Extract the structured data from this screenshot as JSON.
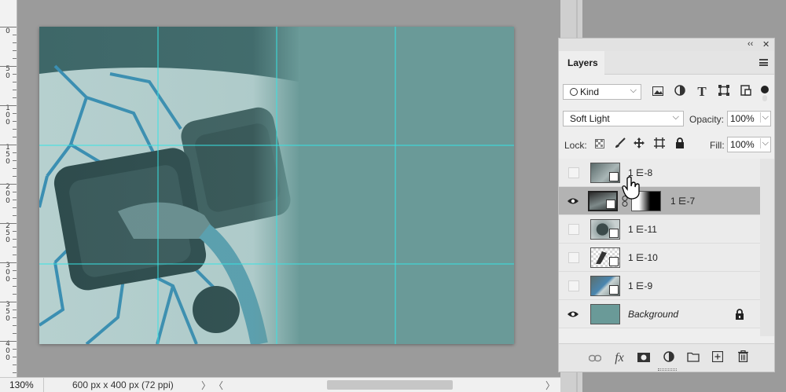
{
  "ruler": {
    "labels": [
      {
        "text": "0"
      },
      {
        "text": "5\n0"
      },
      {
        "text": "1\n0\n0"
      },
      {
        "text": "1\n5\n0"
      },
      {
        "text": "2\n0\n0"
      },
      {
        "text": "2\n5\n0"
      },
      {
        "text": "3\n0\n0"
      },
      {
        "text": "3\n5\n0"
      },
      {
        "text": "4\n0\n0"
      }
    ]
  },
  "panel": {
    "collapse_icon": "‹‹",
    "close_icon": "✕",
    "tab_label": "Layers",
    "filter": {
      "label": "Kind",
      "chevron": "⌵"
    },
    "blend_mode": {
      "value": "Soft Light",
      "chevron": "⌵"
    },
    "opacity": {
      "label": "Opacity:",
      "value": "100%",
      "chevron": "⌵"
    },
    "lock": {
      "label": "Lock:"
    },
    "fill": {
      "label": "Fill:",
      "value": "100%",
      "chevron": "⌵"
    },
    "layers": [
      {
        "name": "1 ⋿-8",
        "visible": false,
        "selected": false
      },
      {
        "name": "1 ⋿-7",
        "visible": true,
        "selected": true
      },
      {
        "name": "1 ⋿-11",
        "visible": false,
        "selected": false
      },
      {
        "name": "1 ⋿-10",
        "visible": false,
        "selected": false
      },
      {
        "name": "1 ⋿-9",
        "visible": false,
        "selected": false
      },
      {
        "name": "Background",
        "visible": true,
        "selected": false,
        "locked": true
      }
    ],
    "footer": {
      "fx_label": "fx"
    }
  },
  "status": {
    "zoom": "130%",
    "doc_info": "600 px x 400 px (72 ppi)",
    "arrow_right": "〉",
    "arrow_left": "〈",
    "arrow_end": "〉"
  },
  "colors": {
    "canvas_teal": "#6a9a98",
    "guide_cyan": "#37e3e3",
    "selected_row": "#b3b3b3"
  }
}
